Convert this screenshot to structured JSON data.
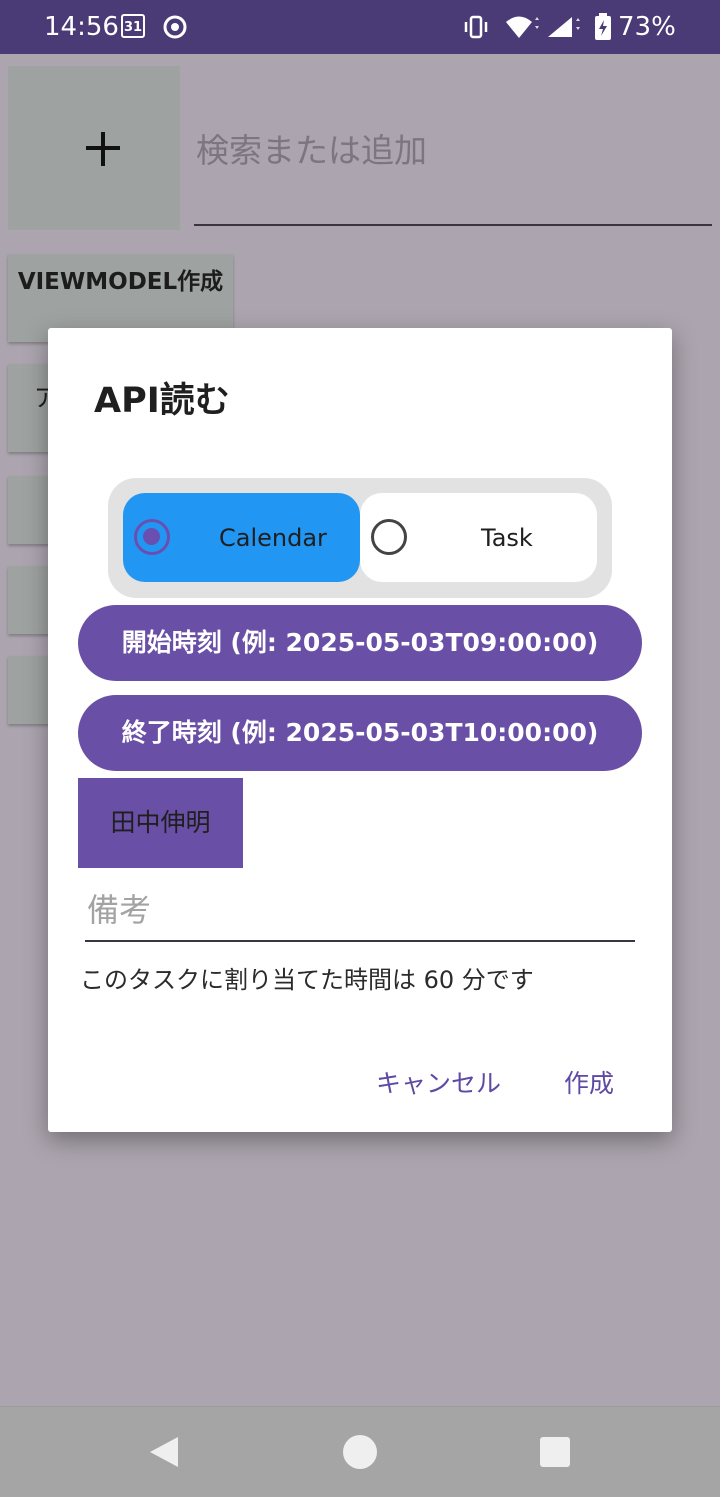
{
  "status_bar": {
    "time": "14:56",
    "calendar_day": "31",
    "battery_percent": "73%",
    "icons": [
      "calendar-icon",
      "chrome-icon",
      "vibrate-icon",
      "wifi-icon",
      "signal-icon",
      "battery-icon"
    ]
  },
  "background": {
    "add_button_icon": "plus-icon",
    "search_placeholder": "検索または追加",
    "buttons": [
      "VIEWMODEL作成",
      "ア"
    ]
  },
  "dialog": {
    "title": "API読む",
    "segments": [
      {
        "label": "Calendar",
        "selected": true
      },
      {
        "label": "Task",
        "selected": false
      }
    ],
    "start_time_button": "開始時刻 (例: 2025-05-03T09:00:00)",
    "end_time_button": "終了時刻 (例: 2025-05-03T10:00:00)",
    "assignee": "田中伸明",
    "memo_placeholder": "備考",
    "info_text": "このタスクに割り当てた時間は 60 分です",
    "cancel_label": "キャンセル",
    "create_label": "作成"
  },
  "colors": {
    "status_bar": "#4a3a76",
    "accent": "#6a4fa7",
    "segment_selected": "#2196f3",
    "scrim_background": "#aca5af"
  },
  "nav_bar": {
    "icons": [
      "back-icon",
      "home-icon",
      "recents-icon"
    ]
  }
}
